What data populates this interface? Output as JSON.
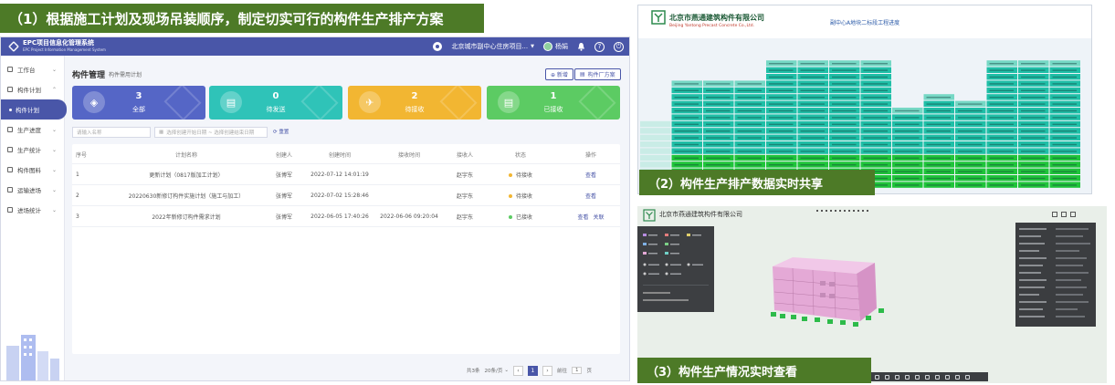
{
  "captions": {
    "c1": "（1）根据施工计划及现场吊装顺序，制定切实可行的构件生产排产方案",
    "c2": "（2）构件生产排产数据实时共享",
    "c3": "（3）构件生产情况实时查看"
  },
  "app": {
    "logo_title": "EPC项目信息化管理系统",
    "logo_sub": "EPC Project Information Management System",
    "project_selector": "北京城市副中心住房项目...",
    "user_name": "杨娟",
    "help_glyph": "?",
    "power_glyph": "⏻",
    "sidebar": [
      {
        "label": "工作台",
        "active": false
      },
      {
        "label": "构件计划",
        "active": false
      },
      {
        "label": "构件计划",
        "active": true
      },
      {
        "label": "生产进度",
        "active": false
      },
      {
        "label": "生产统计",
        "active": false
      },
      {
        "label": "构件图料",
        "active": false
      },
      {
        "label": "运输进场",
        "active": false
      },
      {
        "label": "进场统计",
        "active": false
      }
    ],
    "chevron": "⌄",
    "module_title": "构件管理",
    "module_sub": "构件需用计划",
    "add_button": "⊕ 新增",
    "plan_button": "构件厂方案",
    "cards": [
      {
        "count": "3",
        "label": "全部",
        "icon": "◈"
      },
      {
        "count": "0",
        "label": "待发送",
        "icon": "▤"
      },
      {
        "count": "2",
        "label": "待接收",
        "icon": "✈"
      },
      {
        "count": "1",
        "label": "已接收",
        "icon": "▤"
      }
    ],
    "filter_name_placeholder": "请输入名称",
    "filter_date_placeholder": "选择创建开始日期 ~ 选择创建结束日期",
    "reset_label": "⟳ 重置",
    "columns": [
      "序号",
      "计划名称",
      "创建人",
      "创建时间",
      "接收时间",
      "接收人",
      "状态",
      "操作"
    ],
    "rows": [
      {
        "idx": "1",
        "name": "更新计划（0817版加工计划）",
        "creator": "张博军",
        "ctime": "2022-07-12 14:01:19",
        "rtime": "",
        "receiver": "赵宇东",
        "status": "待接收",
        "status_color": "#f2b632",
        "ops": [
          "查看"
        ]
      },
      {
        "idx": "2",
        "name": "20220630新修订构件实施计划（施工与加工）",
        "creator": "张博军",
        "ctime": "2022-07-02 15:28:46",
        "rtime": "",
        "receiver": "赵宇东",
        "status": "待接收",
        "status_color": "#f2b632",
        "ops": [
          "查看"
        ]
      },
      {
        "idx": "3",
        "name": "2022年新修订构件需求计划",
        "creator": "张博军",
        "ctime": "2022-06-05 17:40:26",
        "rtime": "2022-06-06 09:20:04",
        "receiver": "赵宇东",
        "status": "已接收",
        "status_color": "#5ccb63",
        "ops": [
          "查看",
          "关联"
        ]
      }
    ],
    "pager": {
      "total": "共3条",
      "page_size": "20条/页",
      "prev": "‹",
      "current": "1",
      "next": "›",
      "goto_label": "前往",
      "goto_value": "1",
      "page_suffix": "页"
    }
  },
  "schedule": {
    "company": "北京市燕通建筑构件有限公司",
    "company_en": "Beijing Yantong Precast Concrete Co.,Ltd.",
    "title": "副中心A地块二标段工程进度",
    "colors": {
      "teal": "#1fbfa7",
      "light_teal": "#76d8c5",
      "green": "#1fc43a",
      "header": "#c9ece6"
    }
  },
  "viewer": {
    "company": "北京市燕通建筑构件有限公司",
    "model_color": "#e4a9d6",
    "panel_color": "#3b3d40"
  }
}
